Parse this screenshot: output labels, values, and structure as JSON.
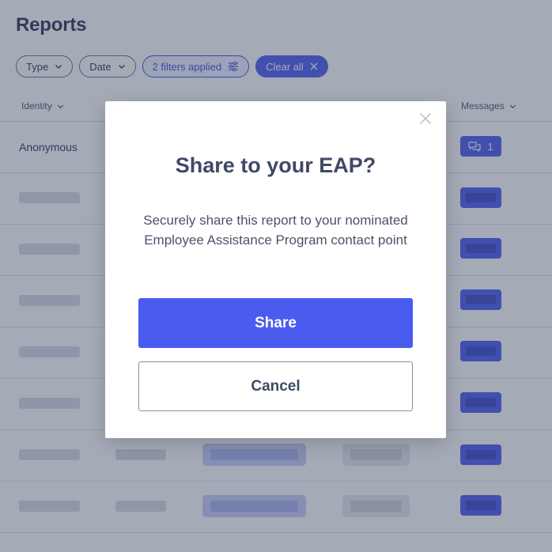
{
  "page": {
    "title": "Reports"
  },
  "filters": {
    "type_label": "Type",
    "date_label": "Date",
    "applied_label": "2 filters applied",
    "clear_label": "Clear all"
  },
  "table": {
    "columns": {
      "identity": "Identity",
      "messages": "Messages"
    },
    "first_row": {
      "identity": "Anonymous",
      "message_count": "1"
    }
  },
  "modal": {
    "title": "Share to your EAP?",
    "body": "Securely share this report to your nominated Employee Assistance Program contact point",
    "share_label": "Share",
    "cancel_label": "Cancel"
  },
  "colors": {
    "accent": "#4a5cf0",
    "text_dark": "#2d3552",
    "overlay": "rgba(56,66,96,0.45)"
  },
  "icons": {
    "chip_chevron": "chevron-down-icon",
    "applied": "sliders-icon",
    "clear": "close-icon",
    "message": "chat-bubbles-icon",
    "modal_close": "close-icon"
  }
}
